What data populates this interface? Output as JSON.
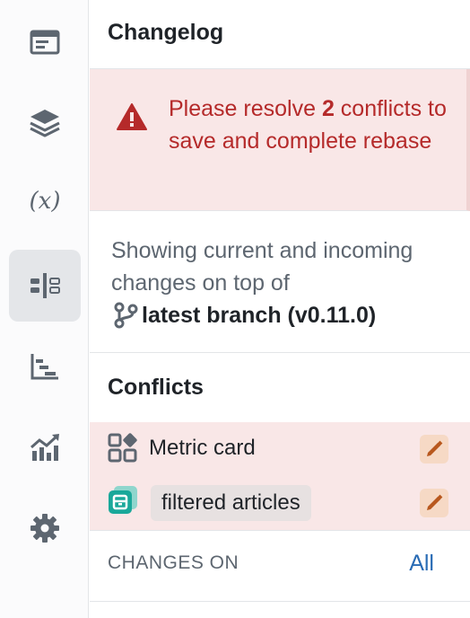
{
  "rail": {
    "items": [
      {
        "name": "layout-icon",
        "active": false
      },
      {
        "name": "layers-icon",
        "active": false
      },
      {
        "name": "variables-icon",
        "label": "(x)",
        "active": false
      },
      {
        "name": "compare-icon",
        "active": true
      },
      {
        "name": "timeline-icon",
        "active": false
      },
      {
        "name": "chart-trend-icon",
        "active": false
      },
      {
        "name": "gear-icon",
        "active": false
      }
    ]
  },
  "panel": {
    "title": "Changelog",
    "alert": {
      "prefix": "Please resolve ",
      "count": "2",
      "suffix": " conflicts to save and complete rebase"
    },
    "info": {
      "text": "Showing current and incoming changes on top of",
      "branch_label": "latest branch (v0.11.0)"
    },
    "conflicts": {
      "heading": "Conflicts",
      "items": [
        {
          "label": "Metric card",
          "icon": "widget-grid-icon"
        },
        {
          "label": "filtered articles",
          "icon": "dataset-icon"
        }
      ]
    },
    "changes_on": {
      "label": "CHANGES ON",
      "value": "All"
    }
  },
  "colors": {
    "alert_bg": "#f9e7e7",
    "alert_text": "#b52a2a",
    "link": "#2a6cb5",
    "active_rail": "#e4e6e9",
    "edit_bg": "#f6d9c5",
    "dataset_icon": "#1aa89a"
  }
}
